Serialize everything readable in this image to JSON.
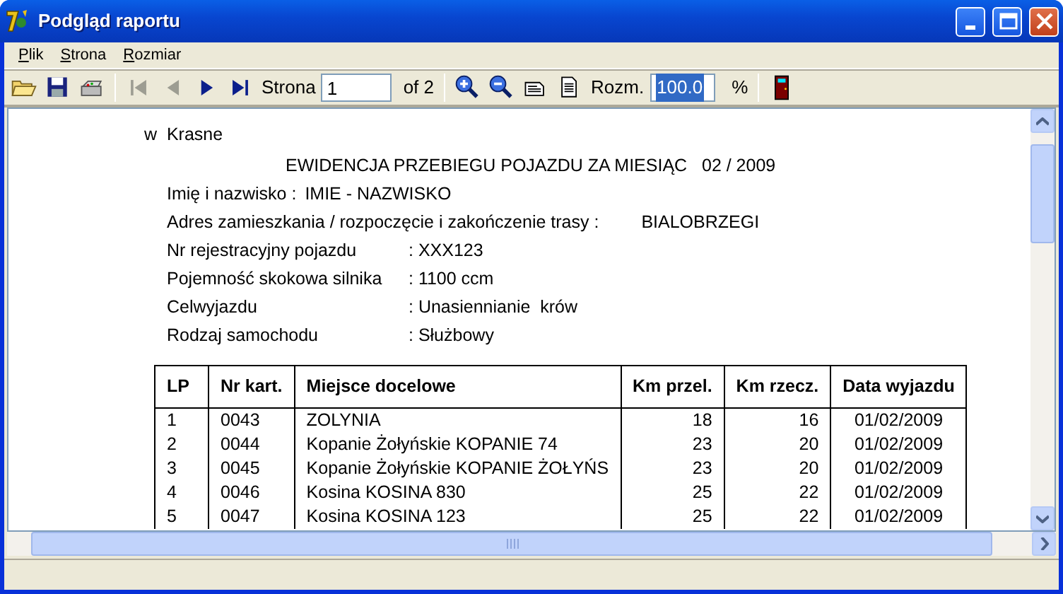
{
  "window": {
    "title": "Podgląd raportu"
  },
  "menu": [
    {
      "label": "Plik"
    },
    {
      "label": "Strona"
    },
    {
      "label": "Rozmiar"
    }
  ],
  "toolbar": {
    "file_buttons": [
      {
        "kind": "open"
      },
      {
        "kind": "save"
      },
      {
        "kind": "print"
      }
    ],
    "nav_buttons": [
      {
        "kind": "first",
        "disabled": true
      },
      {
        "kind": "prev",
        "disabled": true
      },
      {
        "kind": "next",
        "disabled": false
      },
      {
        "kind": "last",
        "disabled": false
      }
    ],
    "page_label": "Strona",
    "page_value": "1",
    "page_total": "of 2",
    "view_buttons": [
      {
        "kind": "zoom-in"
      },
      {
        "kind": "zoom-out"
      },
      {
        "kind": "page-width"
      },
      {
        "kind": "whole-page"
      }
    ],
    "zoom_label": "Rozm.",
    "zoom_value": "100.0",
    "zoom_value_selected": true,
    "zoom_unit": "%"
  },
  "report": {
    "address": "w  Krasne",
    "title": "EWIDENCJA PRZEBIEGU POJAZDU ZA MIESIĄC   02 / 2009",
    "fields": [
      {
        "kind": "inline",
        "label": "Imię i nazwisko :",
        "value": "IMIE - NAZWISKO"
      },
      {
        "kind": "inline",
        "label": "Adres zamieszkania / rozpoczęcie i zakończenie trasy :",
        "value": "BIALOBRZEGI"
      },
      {
        "kind": "aligned",
        "label": "Nr rejestracyjny pojazdu",
        "value": ": XXX123"
      },
      {
        "kind": "aligned",
        "label": "Pojemność skokowa silnika",
        "value": ": 1100 ccm"
      },
      {
        "kind": "aligned",
        "label": "Celwyjazdu",
        "value": ": Unasiennianie  krów"
      },
      {
        "kind": "aligned",
        "label": "Rodzaj samochodu",
        "value": ": Służbowy"
      }
    ],
    "table": {
      "columns": [
        "LP",
        "Nr kart.",
        "Miejsce docelowe",
        "Km przel.",
        "Km rzecz.",
        "Data wyjazdu"
      ],
      "rows": [
        [
          "1",
          "0043",
          "ZOLYNIA",
          "18",
          "16",
          "01/02/2009"
        ],
        [
          "2",
          "0044",
          "Kopanie Żołyńskie KOPANIE 74",
          "23",
          "20",
          "01/02/2009"
        ],
        [
          "3",
          "0045",
          "Kopanie Żołyńskie KOPANIE ŻOŁYŃS",
          "23",
          "20",
          "01/02/2009"
        ],
        [
          "4",
          "0046",
          "Kosina KOSINA 830",
          "25",
          "22",
          "01/02/2009"
        ],
        [
          "5",
          "0047",
          "Kosina KOSINA 123",
          "25",
          "22",
          "01/02/2009"
        ]
      ]
    }
  }
}
